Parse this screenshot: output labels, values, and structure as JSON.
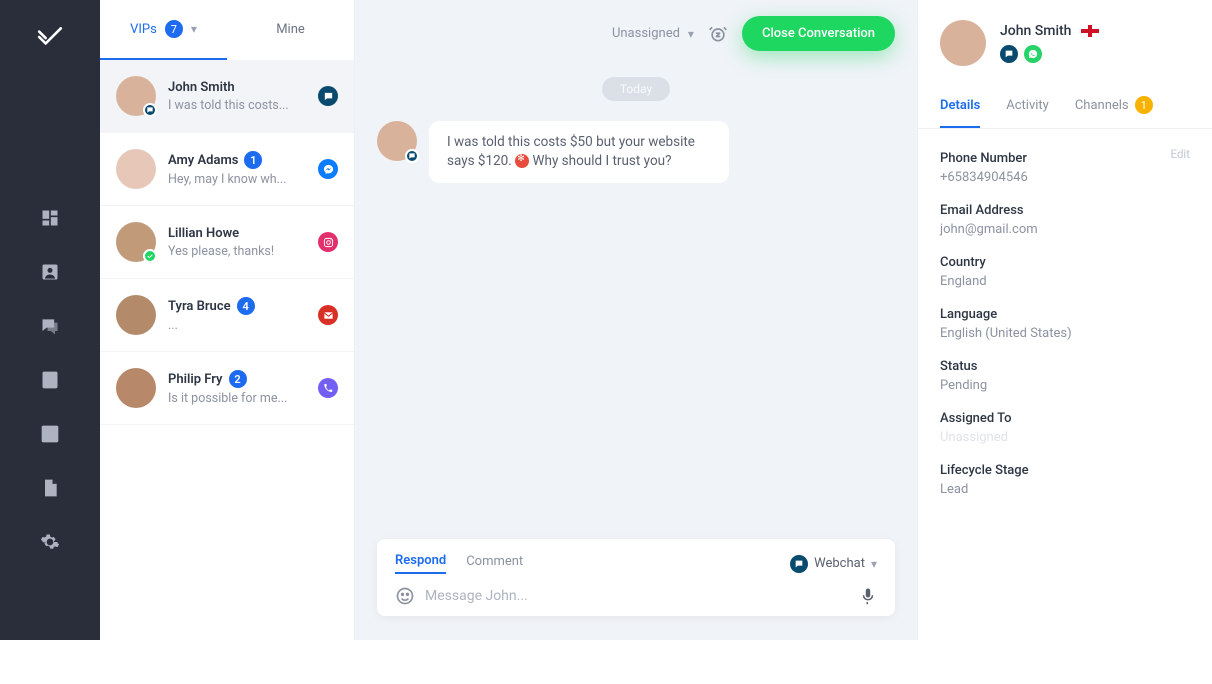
{
  "sidebar": {
    "items": [
      "dashboard",
      "contacts",
      "messages",
      "forms",
      "reports",
      "files",
      "settings"
    ]
  },
  "inbox": {
    "tabs": {
      "vips_label": "VIPs",
      "vips_count": "7",
      "mine_label": "Mine"
    },
    "items": [
      {
        "name": "John Smith",
        "preview": "I was told this costs...",
        "badge": "",
        "channel": "webchat",
        "avatar_bg": "#d8b29a",
        "active": true
      },
      {
        "name": "Amy Adams",
        "preview": "Hey, may I know wh...",
        "badge": "1",
        "channel": "messenger",
        "avatar_bg": "#e6c7b8",
        "dot_color": ""
      },
      {
        "name": "Lillian Howe",
        "preview": "Yes please, thanks!",
        "badge": "",
        "channel": "instagram",
        "avatar_bg": "#c19a7a",
        "dot_color": "#1ed760"
      },
      {
        "name": "Tyra Bruce",
        "preview": "...",
        "badge": "4",
        "channel": "gmail",
        "avatar_bg": "#b38b6b"
      },
      {
        "name": "Philip Fry",
        "preview": "Is it possible for me...",
        "badge": "2",
        "channel": "viber",
        "avatar_bg": "#b7896a"
      }
    ]
  },
  "conversation": {
    "assign_label": "Unassigned",
    "close_label": "Close Conversation",
    "day": "Today",
    "message_pre": "I was told this costs $50 but your website says $120. ",
    "message_post": " Why should I trust you?"
  },
  "composer": {
    "respond_label": "Respond",
    "comment_label": "Comment",
    "channel_label": "Webchat",
    "placeholder": "Message John..."
  },
  "details": {
    "name": "John Smith",
    "tabs": {
      "details": "Details",
      "activity": "Activity",
      "channels": "Channels",
      "channels_count": "1"
    },
    "edit_label": "Edit",
    "fields": {
      "phone_label": "Phone Number",
      "phone_value": "+65834904546",
      "email_label": "Email Address",
      "email_value": "john@gmail.com",
      "country_label": "Country",
      "country_value": "England",
      "language_label": "Language",
      "language_value": "English (United States)",
      "status_label": "Status",
      "status_value": "Pending",
      "assigned_label": "Assigned To",
      "assigned_value": "Unassigned",
      "lifecycle_label": "Lifecycle Stage",
      "lifecycle_value": "Lead"
    }
  },
  "colors": {
    "webchat": "#0a4a6e",
    "messenger": "#0a7cff",
    "instagram": "#e1306c",
    "gmail": "#d93025",
    "viber": "#7360f2",
    "whatsapp": "#25d366",
    "check": "#1ed760"
  }
}
